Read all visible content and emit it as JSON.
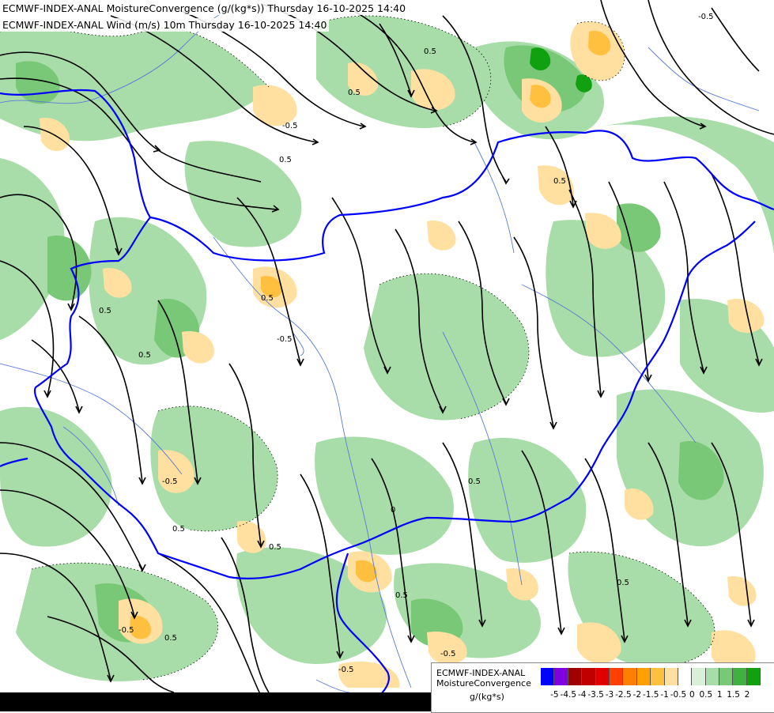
{
  "header": {
    "title_line1": "ECMWF-INDEX-ANAL MoistureConvergence (g/(kg*s)) Thursday 16-10-2025 14:40",
    "title_line2": "ECMWF-INDEX-ANAL Wind (m/s) 10m Thursday 16-10-2025 14:40"
  },
  "legend": {
    "line1": "ECMWF-INDEX-ANAL",
    "line2": "MoistureConvergence",
    "units": "g/(kg*s)",
    "colors": [
      "#0000ff",
      "#8000e0",
      "#a00000",
      "#c00000",
      "#e00000",
      "#ff4000",
      "#ff8000",
      "#ffa000",
      "#ffc040",
      "#ffe0a0",
      "#ffffff",
      "#d8f0d8",
      "#a8dca8",
      "#78c878",
      "#40b040",
      "#10a010"
    ],
    "ticks": [
      "-5",
      "-4.5",
      "-4",
      "-3.5",
      "-3",
      "-2.5",
      "-2",
      "-1.5",
      "-1",
      "-0.5",
      "0",
      "0.5",
      "1",
      "1.5",
      "2"
    ]
  },
  "contour_labels": [
    "-0.5",
    "0.5",
    "0.5",
    "-0.5",
    "0.5",
    "0.5",
    "0.5",
    "-0.5",
    "0.5",
    "0.5",
    "-0.5",
    "0.5",
    "0.5",
    "0",
    "0.5",
    "0.5",
    "-0.5",
    "-0.5",
    "0.5",
    "0.5",
    "-0.5"
  ],
  "colors": {
    "border": "#0000ff",
    "rivers": "#5a7ad8",
    "streamlines": "#000000",
    "convergence_light": "#a8dca8",
    "convergence_mid": "#78c878",
    "convergence_dark": "#10a010",
    "divergence_light": "#ffe0a0",
    "divergence_mid": "#ffc040",
    "divergence_strong": "#ffa000"
  }
}
